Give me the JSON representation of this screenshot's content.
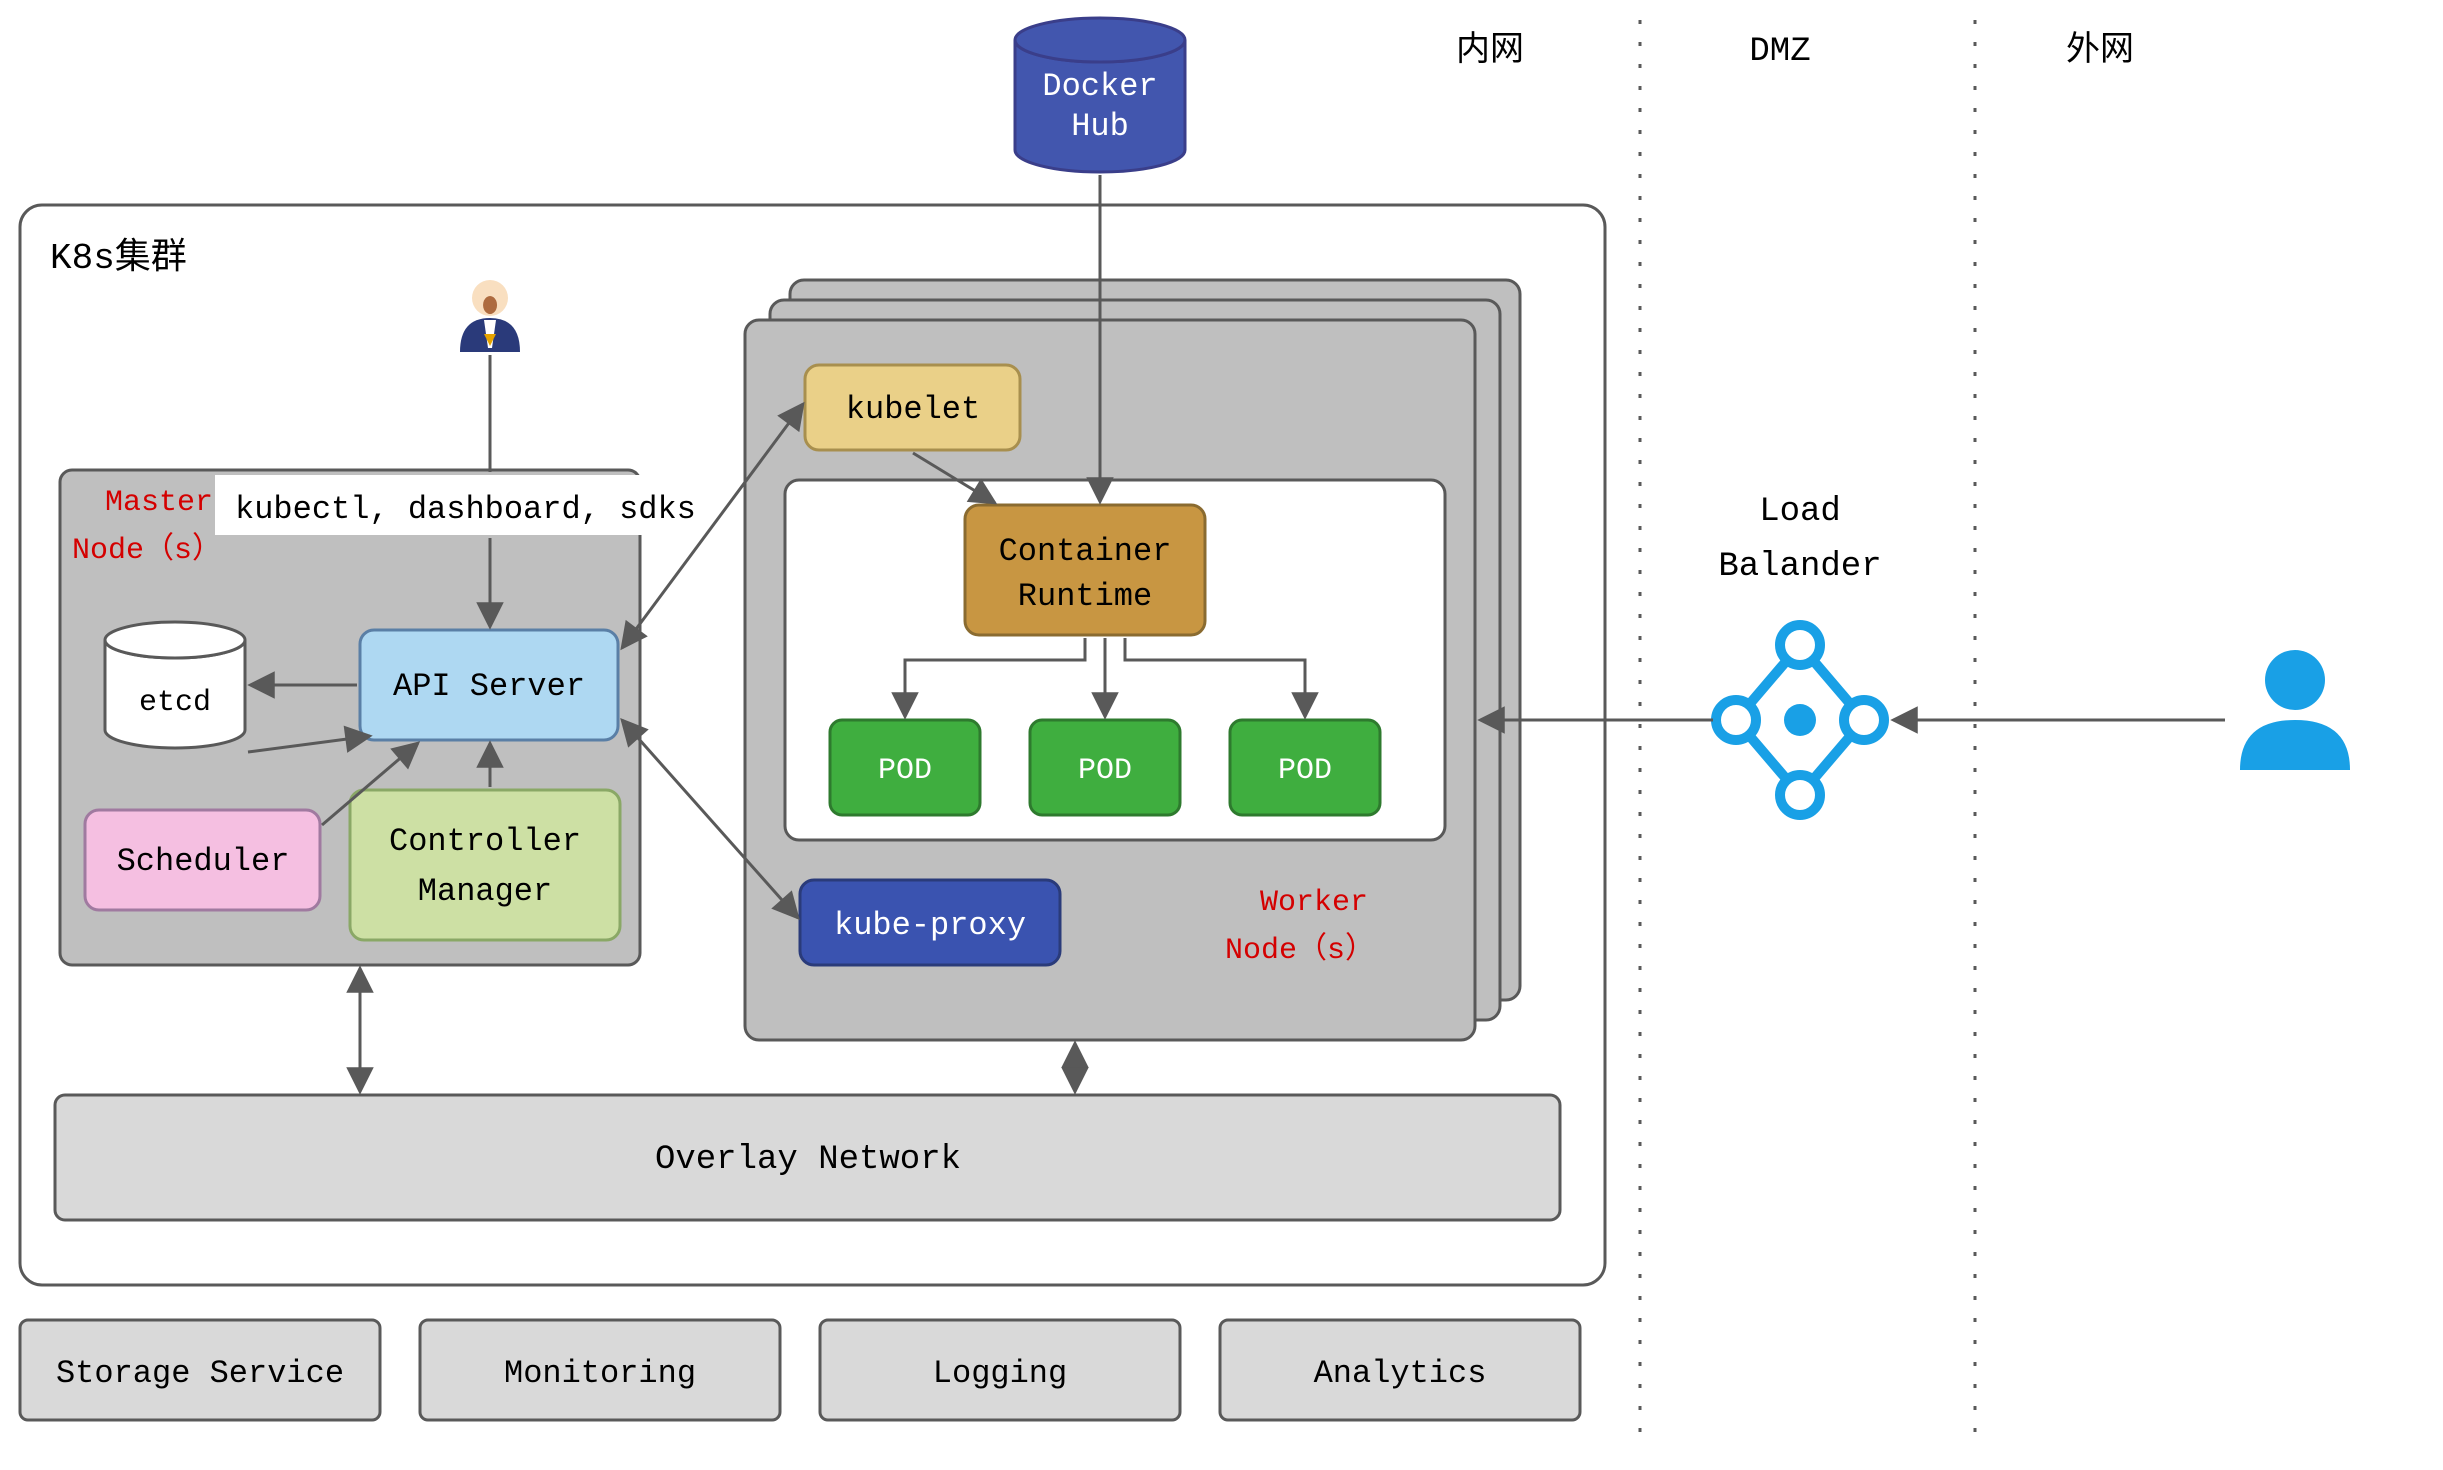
{
  "zones": {
    "intranet": "内网",
    "dmz": "DMZ",
    "internet": "外网"
  },
  "dockerHub": "Docker\nHub",
  "cluster": {
    "title": "K8s集群"
  },
  "master": {
    "title": "Master\nNode（s）",
    "kubectl": "kubectl, dashboard, sdks",
    "etcd": "etcd",
    "apiServer": "API Server",
    "scheduler": "Scheduler",
    "controllerManager": "Controller\nManager"
  },
  "worker": {
    "title": "Worker\nNode（s）",
    "kubelet": "kubelet",
    "containerRuntime": "Container\nRuntime",
    "pods": [
      "POD",
      "POD",
      "POD"
    ],
    "kubeProxy": "kube-proxy"
  },
  "overlay": "Overlay Network",
  "services": [
    "Storage Service",
    "Monitoring",
    "Logging",
    "Analytics"
  ],
  "loadBalancer": "Load\nBalander"
}
